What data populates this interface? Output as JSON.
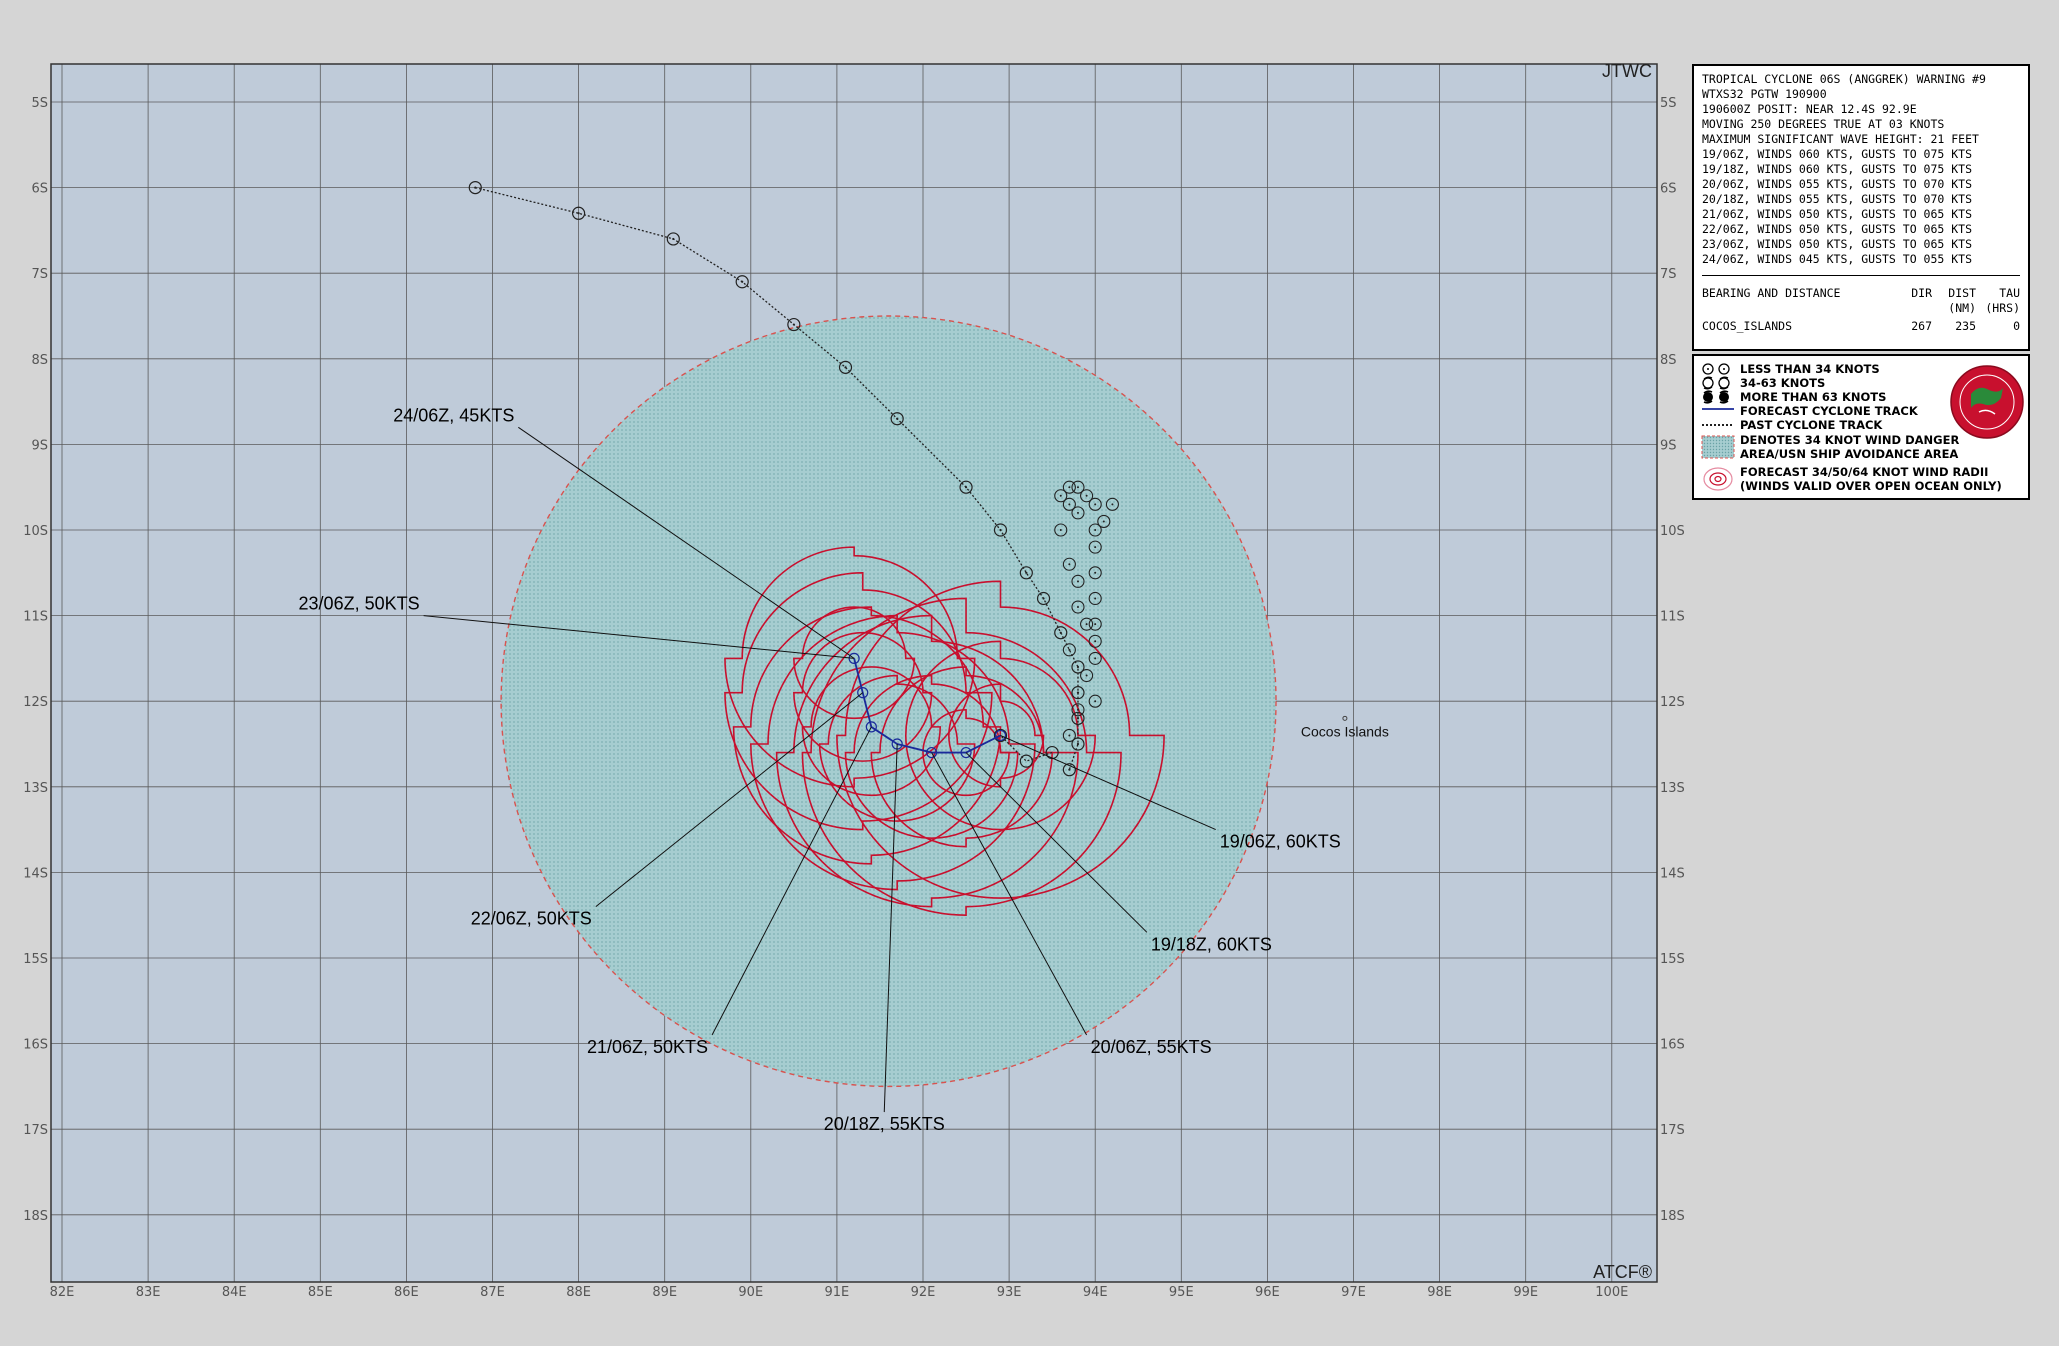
{
  "map": {
    "corner_top_right": "JTWC",
    "corner_bottom_right": "ATCF®",
    "lon_labels": [
      "82E",
      "83E",
      "84E",
      "85E",
      "86E",
      "87E",
      "88E",
      "89E",
      "90E",
      "91E",
      "92E",
      "93E",
      "94E",
      "95E",
      "96E",
      "97E",
      "98E",
      "99E",
      "100E"
    ],
    "lat_labels": [
      "5S",
      "6S",
      "7S",
      "8S",
      "9S",
      "10S",
      "11S",
      "12S",
      "13S",
      "14S",
      "15S",
      "16S",
      "17S",
      "18S"
    ],
    "lon_range": [
      82,
      100.6
    ],
    "lat_range": [
      4.55,
      18.75
    ],
    "place": {
      "name": "Cocos Islands",
      "lon": 96.9,
      "lat": 12.2
    },
    "danger_area": {
      "center_lon": 91.6,
      "center_lat": 12.0,
      "radius_deg": 4.5
    },
    "past_track": [
      [
        86.8,
        6.0
      ],
      [
        88.0,
        6.3
      ],
      [
        89.1,
        6.6
      ],
      [
        89.9,
        7.1
      ],
      [
        90.5,
        7.6
      ],
      [
        91.1,
        8.1
      ],
      [
        91.7,
        8.7
      ],
      [
        92.5,
        9.5
      ],
      [
        92.9,
        10.0
      ],
      [
        93.2,
        10.5
      ],
      [
        93.4,
        10.8
      ],
      [
        93.6,
        11.2
      ],
      [
        93.8,
        11.6
      ],
      [
        93.8,
        11.9
      ],
      [
        93.8,
        12.2
      ],
      [
        93.8,
        12.5
      ],
      [
        93.7,
        12.8
      ]
    ],
    "stationary_marks": [
      [
        93.6,
        9.6
      ],
      [
        93.7,
        9.5
      ],
      [
        93.8,
        9.5
      ],
      [
        93.9,
        9.6
      ],
      [
        93.7,
        9.7
      ],
      [
        93.8,
        9.8
      ],
      [
        94.0,
        9.7
      ],
      [
        94.2,
        9.7
      ],
      [
        94.1,
        9.9
      ],
      [
        94.0,
        10.0
      ],
      [
        94.0,
        10.2
      ],
      [
        94.0,
        10.5
      ],
      [
        94.0,
        10.8
      ],
      [
        94.0,
        11.1
      ],
      [
        94.0,
        11.3
      ],
      [
        94.0,
        11.5
      ],
      [
        93.6,
        10.0
      ],
      [
        93.7,
        10.4
      ],
      [
        93.8,
        10.6
      ],
      [
        93.8,
        10.9
      ],
      [
        93.9,
        11.1
      ],
      [
        93.7,
        11.4
      ],
      [
        93.9,
        11.7
      ],
      [
        94.0,
        12.0
      ],
      [
        93.8,
        12.1
      ],
      [
        93.7,
        12.4
      ]
    ],
    "initial_track": [
      [
        93.5,
        12.6
      ],
      [
        93.2,
        12.7
      ],
      [
        92.9,
        12.4
      ]
    ],
    "forecast_track": [
      [
        92.9,
        12.4
      ],
      [
        92.5,
        12.6
      ],
      [
        92.1,
        12.6
      ],
      [
        91.7,
        12.5
      ],
      [
        91.4,
        12.3
      ],
      [
        91.3,
        11.9
      ],
      [
        91.2,
        11.5
      ]
    ],
    "forecast_points": [
      {
        "label": "19/06Z,  60KTS",
        "lon": 92.9,
        "lat": 12.4,
        "label_lon": 95.4,
        "label_lat": 13.5
      },
      {
        "label": "19/18Z,  60KTS",
        "lon": 92.5,
        "lat": 12.6,
        "label_lon": 94.6,
        "label_lat": 14.7
      },
      {
        "label": "20/06Z,  55KTS",
        "lon": 92.1,
        "lat": 12.6,
        "label_lon": 93.9,
        "label_lat": 15.9
      },
      {
        "label": "20/18Z,  55KTS",
        "lon": 91.7,
        "lat": 12.5,
        "label_lon": 91.55,
        "label_lat": 16.8
      },
      {
        "label": "21/06Z,  50KTS",
        "lon": 91.4,
        "lat": 12.3,
        "label_lon": 89.55,
        "label_lat": 15.9
      },
      {
        "label": "22/06Z,  50KTS",
        "lon": 91.3,
        "lat": 11.9,
        "label_lon": 88.2,
        "label_lat": 14.4
      },
      {
        "label": "23/06Z,  50KTS",
        "lon": 91.2,
        "lat": 11.5,
        "label_lon": 86.2,
        "label_lat": 11.0
      },
      {
        "label": "24/06Z,  45KTS",
        "lon": 91.2,
        "lat": 11.5,
        "label_lon": 87.3,
        "label_lat": 8.8
      }
    ],
    "wind_radii": [
      {
        "lon": 92.9,
        "lat": 12.4,
        "r34": [
          1.5,
          1.9,
          1.9,
          1.8
        ],
        "r50": [
          0.9,
          1.1,
          1.1,
          1.1
        ],
        "r64": [
          0.4,
          0.5,
          0.6,
          0.6
        ]
      },
      {
        "lon": 92.5,
        "lat": 12.6,
        "r34": [
          1.4,
          1.8,
          1.9,
          1.8
        ],
        "r50": [
          0.9,
          1.0,
          1.1,
          1.0
        ],
        "r64": [
          0.4,
          0.5,
          0.5,
          0.5
        ]
      },
      {
        "lon": 92.1,
        "lat": 12.6,
        "r34": [
          1.3,
          1.7,
          1.8,
          1.6
        ],
        "r50": [
          0.8,
          1.0,
          1.0,
          0.9
        ]
      },
      {
        "lon": 91.7,
        "lat": 12.5,
        "r34": [
          1.3,
          1.6,
          1.7,
          1.5
        ],
        "r50": [
          0.7,
          0.9,
          0.9,
          0.8
        ]
      },
      {
        "lon": 91.4,
        "lat": 12.3,
        "r34": [
          1.3,
          1.5,
          1.6,
          1.4
        ],
        "r50": [
          0.7,
          0.8,
          0.8,
          0.7
        ]
      },
      {
        "lon": 91.3,
        "lat": 11.9,
        "r34": [
          1.2,
          1.5,
          1.6,
          1.4
        ],
        "r50": [
          0.7,
          0.8,
          0.8,
          0.7
        ]
      },
      {
        "lon": 91.2,
        "lat": 11.5,
        "r34": [
          1.2,
          1.4,
          1.5,
          1.3
        ],
        "r50": [
          0.6,
          0.7,
          0.7,
          0.6
        ]
      }
    ],
    "colors": {
      "ocean": "#bfcbd9",
      "grid": "#555555",
      "danger_fill": "#9ec6c9",
      "danger_edge": "#d9534f",
      "radii": "#c8102e",
      "forecast": "#1a2a9a",
      "track": "#222222"
    }
  },
  "info_box": {
    "lines": [
      "TROPICAL CYCLONE 06S (ANGGREK) WARNING #9",
      "WTXS32 PGTW 190900",
      "190600Z POSIT: NEAR 12.4S 92.9E",
      "MOVING 250 DEGREES TRUE AT 03 KNOTS",
      "MAXIMUM SIGNIFICANT WAVE HEIGHT: 21 FEET",
      "19/06Z, WINDS 060 KTS, GUSTS TO 075 KTS",
      "19/18Z, WINDS 060 KTS, GUSTS TO 075 KTS",
      "20/06Z, WINDS 055 KTS, GUSTS TO 070 KTS",
      "20/18Z, WINDS 055 KTS, GUSTS TO 070 KTS",
      "21/06Z, WINDS 050 KTS, GUSTS TO 065 KTS",
      "22/06Z, WINDS 050 KTS, GUSTS TO 065 KTS",
      "23/06Z, WINDS 050 KTS, GUSTS TO 065 KTS",
      "24/06Z, WINDS 045 KTS, GUSTS TO 055 KTS"
    ],
    "bearing": {
      "title": "BEARING AND DISTANCE",
      "col_dir": "DIR",
      "col_dist": "DIST",
      "col_dist_unit": "(NM)",
      "col_tau": "TAU",
      "col_tau_unit": "(HRS)",
      "row_name": "COCOS_ISLANDS",
      "row_dir": "267",
      "row_dist": "235",
      "row_tau": "0"
    }
  },
  "legend": {
    "items": [
      "LESS THAN 34 KNOTS",
      "34-63 KNOTS",
      "MORE THAN 63 KNOTS",
      "FORECAST CYCLONE TRACK",
      "PAST CYCLONE TRACK",
      "DENOTES 34 KNOT WIND DANGER",
      "AREA/USN SHIP AVOIDANCE AREA",
      "FORECAST 34/50/64 KNOT WIND RADII",
      "(WINDS VALID OVER OPEN OCEAN ONLY)"
    ]
  }
}
